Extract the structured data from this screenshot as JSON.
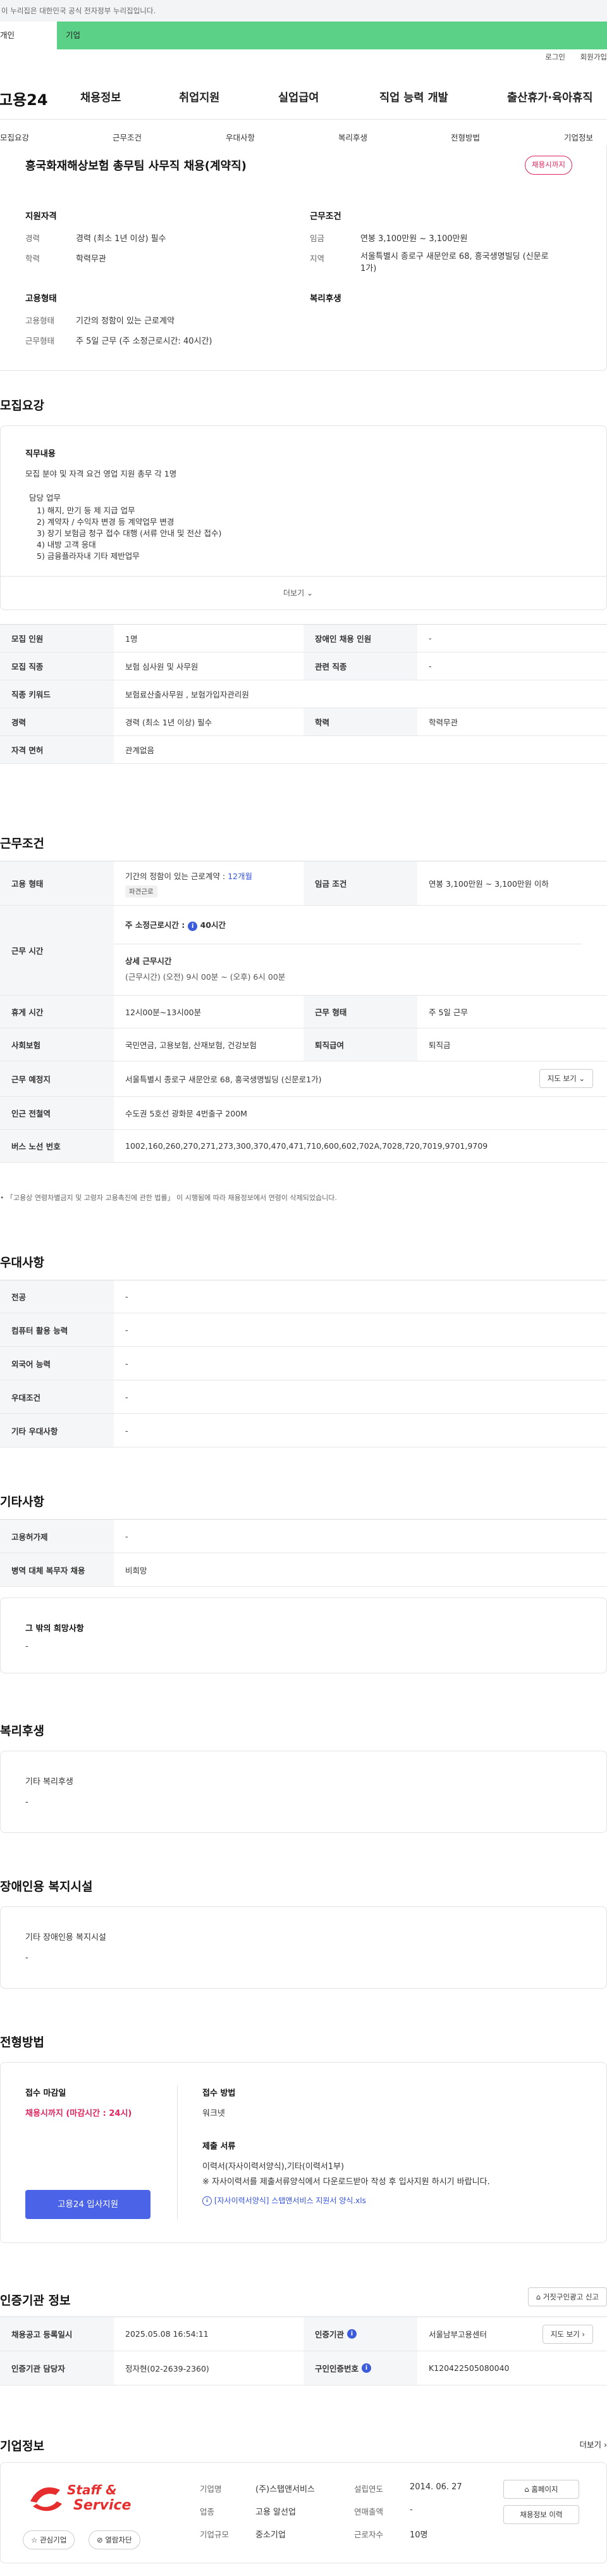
{
  "gov_banner": "이 누리집은 대한민국 공식 전자정부 누리집입니다.",
  "tabs": {
    "personal": "개인",
    "company": "기업"
  },
  "util_links": {
    "login": "로그인",
    "join": "회원가입"
  },
  "logo": "고용24",
  "gnb": [
    "채용정보",
    "취업지원",
    "실업급여",
    "직업 능력 개발",
    "출산휴가·육아휴직"
  ],
  "snb": [
    "모집요강",
    "근무조건",
    "우대사항",
    "복리후생",
    "전형방법",
    "기업정보"
  ],
  "summary": {
    "title": "흥국화재해상보험 총무팀 사무직 채용(계약직)",
    "status_badge": "채용시까지",
    "qual_heading": "지원자격",
    "career_label": "경력",
    "career_value": "경력 (최소 1년 이상) 필수",
    "edu_label": "학력",
    "edu_value": "학력무관",
    "cond_heading": "근무조건",
    "wage_label": "임금",
    "wage_value": "연봉 3,100만원 ~ 3,100만원",
    "region_label": "지역",
    "region_value_1": "서울특별시 종로구 새문안로 68, 흥국생명빌딩 (신문로",
    "region_value_2": "1가)",
    "emp_heading": "고용형태",
    "emp_type_label": "고용형태",
    "emp_type_value": "기간의 정함이 있는 근로계약",
    "work_type_label": "근무형태",
    "work_type_value": "주 5일 근무 (주 소정근로시간: 40시간)",
    "welfare_heading": "복리후생"
  },
  "recruit": {
    "heading": "모집요강",
    "job_heading": "직무내용",
    "job_line": "모집 분야 및 자격 요건 영업 지원 총무 각 1명",
    "duty_title": "담당 업무",
    "duties": [
      "1) 해지, 만기 등 제 지급 업무",
      "2) 계약자 / 수익자 변경 등 계약업무 변경",
      "3) 장기 보험금 청구 접수 대행 (서류 안내 및 전산 접수)",
      "4) 내방 고객 응대",
      "5) 금융플라자내 기타 제반업무"
    ],
    "more": "더보기",
    "table": {
      "count_label": "모집 인원",
      "count_value": "1명",
      "disabled_label": "장애인 채용 인원",
      "disabled_value": "-",
      "job_label": "모집 직종",
      "job_value": "보험 심사원 및 사무원",
      "related_label": "관련 직종",
      "related_value": "-",
      "keyword_label": "직종 키워드",
      "keyword_value": "보험료산출사무원 , 보험가입자관리원",
      "career_label": "경력",
      "career_value": "경력 (최소 1년 이상) 필수",
      "edu_label": "학력",
      "edu_value": "학력무관",
      "license_label": "자격 면허",
      "license_value": "관계없음"
    }
  },
  "conditions": {
    "heading": "근무조건",
    "emp_label": "고용 형태",
    "emp_value": "기간의 정함이 있는 근로계약 : ",
    "emp_months": "12개월",
    "emp_chip": "파견근로",
    "wage_label": "임금 조건",
    "wage_value": "연봉 3,100만원 ~ 3,100만원 이하",
    "hours_label": "근무 시간",
    "hours_weekly": "주 소정근로시간 :",
    "hours_weekly_val": "40시간",
    "hours_detail_title": "상세 근무시간",
    "hours_detail": "(근무시간) (오전) 9시 00분 ~ (오후) 6시 00분",
    "break_label": "휴게 시간",
    "break_value": "12시00분~13시00분",
    "form_label": "근무 형태",
    "form_value": "주 5일 근무",
    "insurance_label": "사회보험",
    "insurance_value": "국민연금, 고용보험, 산재보험, 건강보험",
    "retire_label": "퇴직급여",
    "retire_value": "퇴직금",
    "place_label": "근무 예정지",
    "place_value": "서울특별시 종로구 새문안로 68, 흥국생명빌딩 (신문로1가)",
    "map_btn": "지도 보기",
    "subway_label": "인근 전철역",
    "subway_value": "수도권 5호선 광화문 4번출구 200M",
    "bus_label": "버스 노선 번호",
    "bus_value": "1002,160,260,270,271,273,300,370,470,471,710,600,602,702A,7028,720,7019,9701,9709",
    "note": "「고용상 연령차별금지 및 고령자 고용촉진에 관한 법률」 이 시행됨에 따라 채용정보에서 연령이 삭제되었습니다."
  },
  "preference": {
    "heading": "우대사항",
    "rows": [
      [
        "전공",
        "-"
      ],
      [
        "컴퓨터 활용 능력",
        "-"
      ],
      [
        "외국어 능력",
        "-"
      ],
      [
        "우대조건",
        "-"
      ],
      [
        "기타 우대사항",
        "-"
      ]
    ]
  },
  "etc": {
    "heading": "기타사항",
    "rows": [
      [
        "고용허가제",
        "-"
      ],
      [
        "병역 대체 복무자 채용",
        "비희망"
      ]
    ],
    "other_title": "그 밖의 희망사항",
    "other_value": "-"
  },
  "welfare": {
    "heading": "복리후생",
    "sub": "기타 복리후생",
    "value": "-"
  },
  "disability": {
    "heading": "장애인용 복지시설",
    "sub": "기타 장애인용 복지시설",
    "value": "-"
  },
  "process": {
    "heading": "전형방법",
    "deadline_title": "접수 마감일",
    "deadline_value": "채용시까지 (마감시간 : 24시)",
    "apply_btn": "고용24 입사지원",
    "method_title": "접수 방법",
    "method_value": "워크넷",
    "docs_title": "제출 서류",
    "docs_value": "이력서(자사이력서양식),기타(이력서1부)",
    "docs_note": "※ 자사이력서를 제출서류양식에서 다운로드받아 작성 후 입사지원 하시기 바랍니다.",
    "file": "[자사이력서양식] 스탭앤서비스 지원서 양식.xls"
  },
  "cert": {
    "heading": "인증기관 정보",
    "ad_btn": "거짓구인광고 신고",
    "reg_label": "채용공고 등록일시",
    "reg_value": "2025.05.08 16:54:11",
    "agency_label": "인증기관",
    "agency_value": "서울남부고용센터",
    "agency_btn": "지도 보기",
    "manager_label": "인증기관 담당자",
    "manager_value": "정자현(02-2639-2360)",
    "num_label": "구인인증번호",
    "num_value": "K120422505080040"
  },
  "company": {
    "heading": "기업정보",
    "more": "더보기",
    "logo_line1": "Staff &",
    "logo_line2": "Service",
    "interest_btn": "관심기업",
    "block_btn": "열람차단",
    "name_label": "기업명",
    "name_value": "(주)스탭앤서비스",
    "ind_label": "업종",
    "ind_value": "고용 알선업",
    "size_label": "기업규모",
    "size_value": "중소기업",
    "est_label": "설립연도",
    "est_value": "2014. 06. 27",
    "sales_label": "연매출액",
    "sales_value": "-",
    "emp_label": "근로자수",
    "emp_value": "10명",
    "home_btn": "홈페이지",
    "jobs_btn": "채용정보 이력"
  },
  "colors": {
    "accent": "#3553e0",
    "brand_green": "#5bd187",
    "status_red": "#e0245e",
    "apply_btn": "#4a63e7"
  }
}
